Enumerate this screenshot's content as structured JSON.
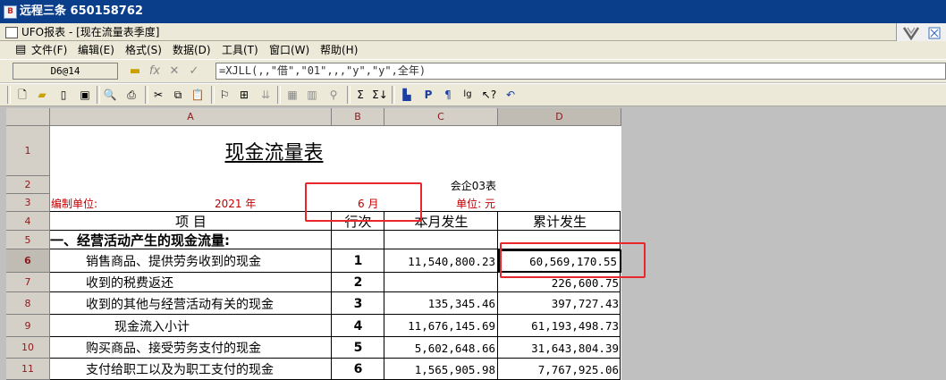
{
  "window": {
    "title": "远程三条  650158762"
  },
  "document": {
    "title": "UFO报表 - [现在流量表季度]"
  },
  "menu": [
    "文件(F)",
    "编辑(E)",
    "格式(S)",
    "数据(D)",
    "工具(T)",
    "窗口(W)",
    "帮助(H)"
  ],
  "formula_bar": {
    "cell_ref": "D6@14",
    "formula": "=XJLL(,,\"借\",\"01\",,,\"y\",\"y\",全年)"
  },
  "columns": [
    "A",
    "B",
    "C",
    "D"
  ],
  "rows": [
    "1",
    "2",
    "3",
    "4",
    "5",
    "6",
    "7",
    "8",
    "9",
    "10",
    "11"
  ],
  "report": {
    "title": "现金流量表",
    "form_code": "会企03表",
    "unit_label": "编制单位:",
    "year": "2021 年",
    "month": "6 月",
    "currency": "单位: 元",
    "headers": {
      "item": "项          目",
      "line": "行次",
      "month_amount": "本月发生",
      "cumulative": "累计发生"
    },
    "section1": "一、经营活动产生的现金流量:",
    "lines": [
      {
        "item": "销售商品、提供劳务收到的现金",
        "line": "1",
        "month": "11,540,800.23",
        "total": "60,569,170.55"
      },
      {
        "item": "收到的税费返还",
        "line": "2",
        "month": "",
        "total": "226,600.75"
      },
      {
        "item": "收到的其他与经营活动有关的现金",
        "line": "3",
        "month": "135,345.46",
        "total": "397,727.43"
      },
      {
        "item": "现金流入小计",
        "line": "4",
        "month": "11,676,145.69",
        "total": "61,193,498.73"
      },
      {
        "item": "购买商品、接受劳务支付的现金",
        "line": "5",
        "month": "5,602,648.66",
        "total": "31,643,804.39"
      },
      {
        "item": "支付给职工以及为职工支付的现金",
        "line": "6",
        "month": "1,565,905.98",
        "total": "7,767,925.06"
      }
    ]
  },
  "icons": {
    "title": "app-icon",
    "doc": "sheet-icon"
  }
}
